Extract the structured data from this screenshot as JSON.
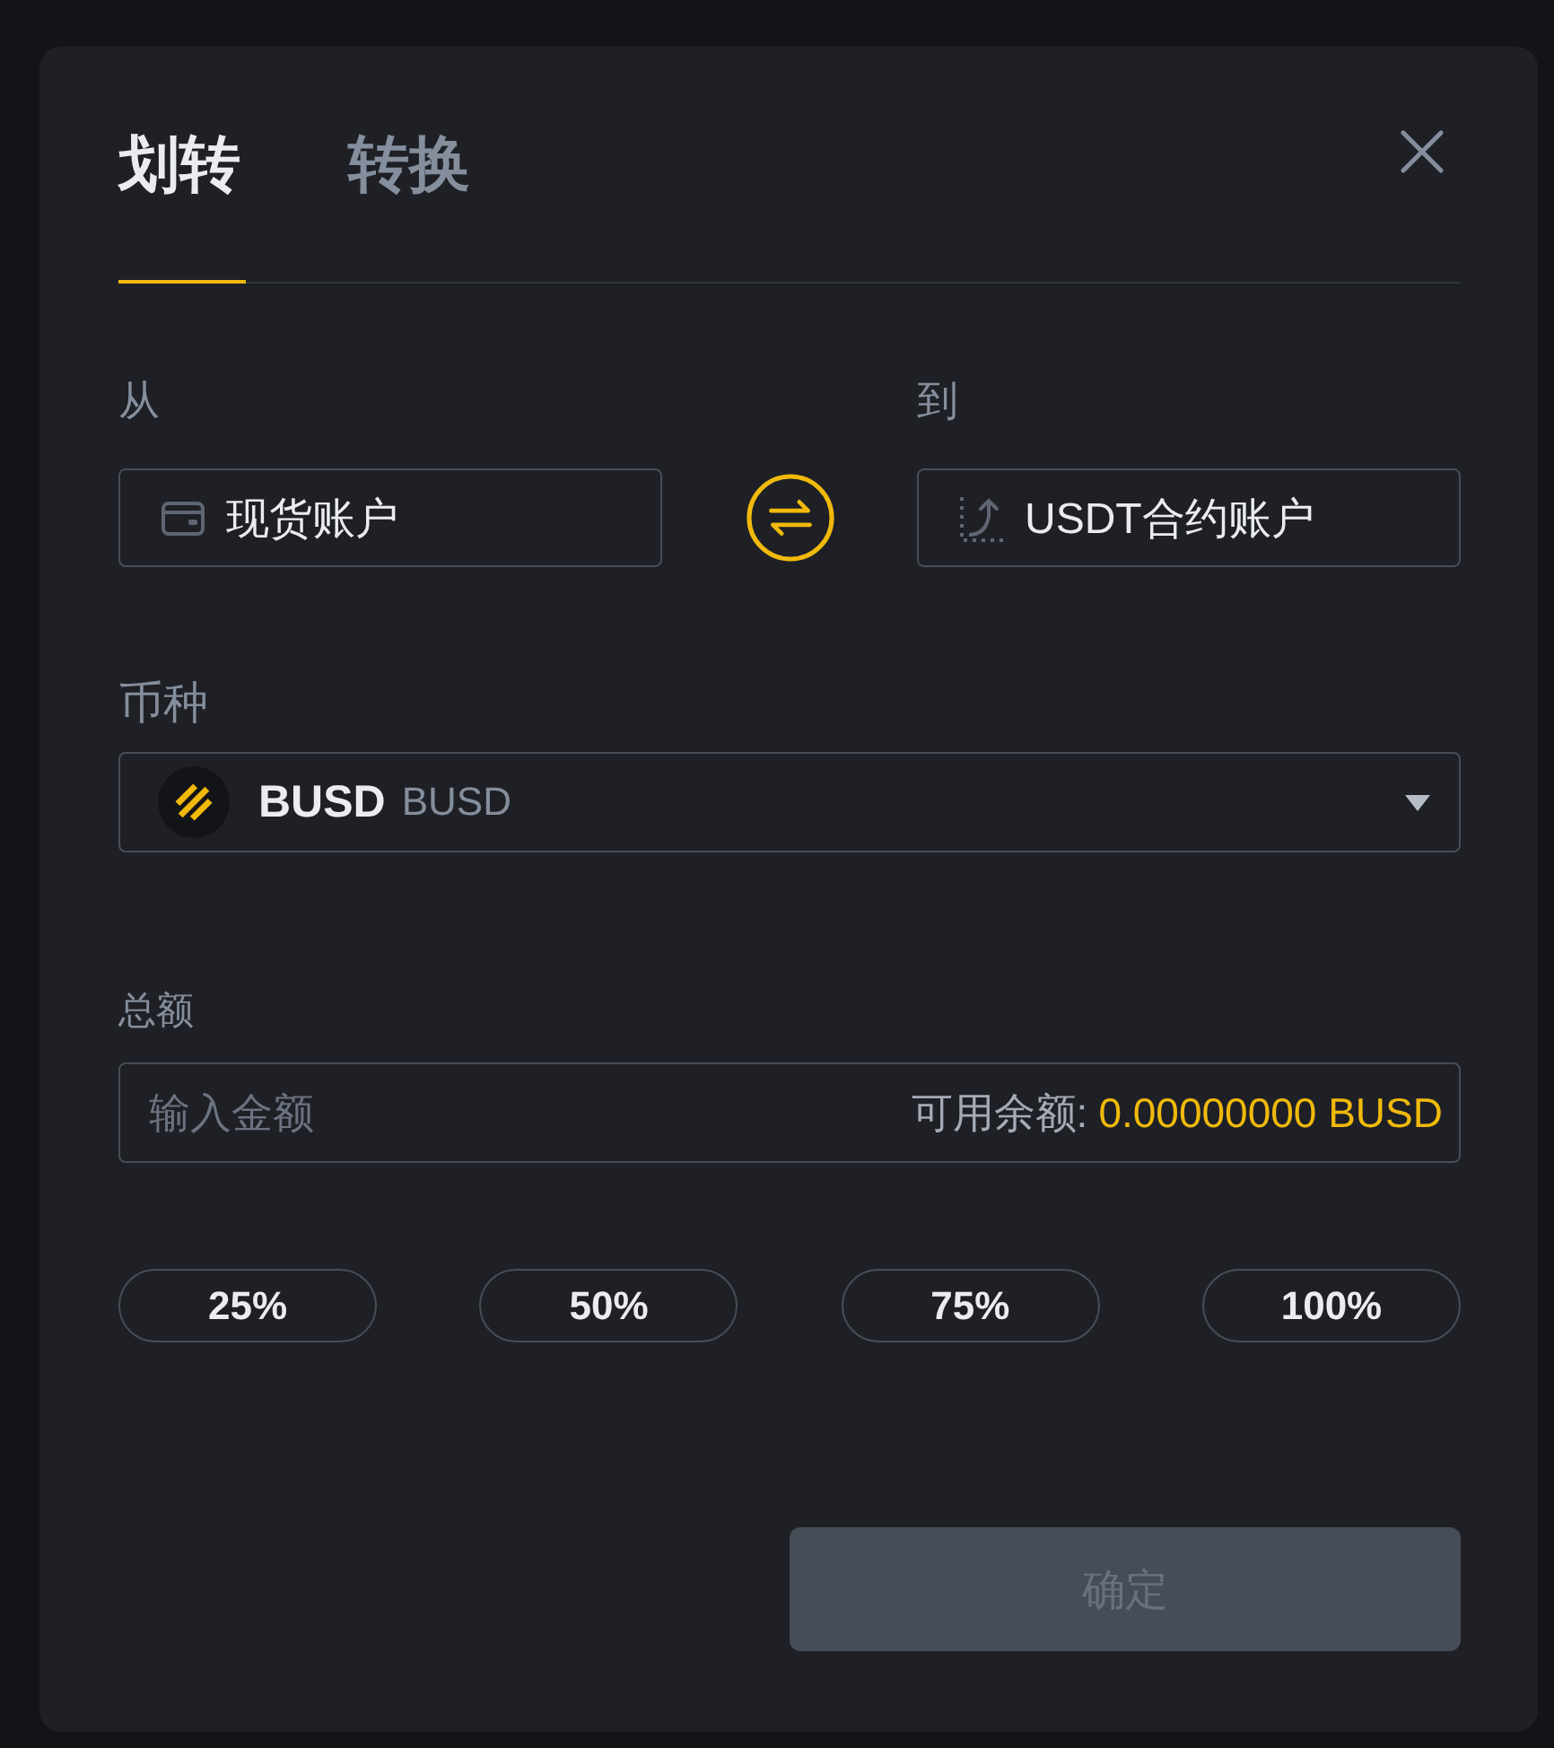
{
  "tabs": [
    {
      "label": "划转",
      "selected": true
    },
    {
      "label": "转换",
      "selected": false
    }
  ],
  "from": {
    "label": "从",
    "account": "现货账户"
  },
  "to": {
    "label": "到",
    "account": "USDT合约账户"
  },
  "coin": {
    "label": "币种",
    "symbol": "BUSD",
    "name": "BUSD"
  },
  "amount": {
    "label": "总额",
    "placeholder": "输入金额",
    "available_label": "可用余额:",
    "available_value": "0.00000000 BUSD"
  },
  "percent_buttons": [
    "25%",
    "50%",
    "75%",
    "100%"
  ],
  "confirm_button": {
    "label": "确定",
    "disabled": true
  }
}
